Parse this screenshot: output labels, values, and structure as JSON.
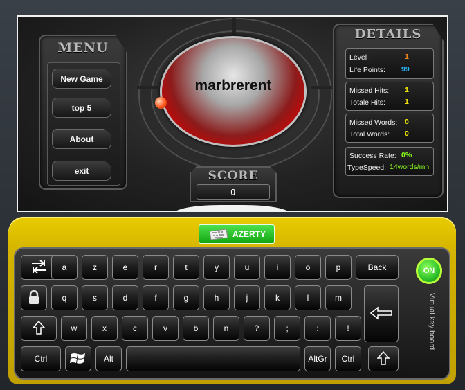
{
  "menu": {
    "title": "MENU",
    "items": [
      "New Game",
      "top 5",
      "About",
      "exit"
    ]
  },
  "details": {
    "title": "DETAILS",
    "level_label": "Level   :",
    "level_value": "1",
    "life_label": "Life Points:",
    "life_value": "99",
    "missed_hits_label": "Missed Hits:",
    "missed_hits_value": "1",
    "total_hits_label": "Totale Hits:",
    "total_hits_value": "1",
    "missed_words_label": "Missed Words:",
    "missed_words_value": "0",
    "total_words_label": "Total Words:",
    "total_words_value": "0",
    "success_label": "Success Rate:",
    "success_value": "0%",
    "speed_label": "TypeSpeed:",
    "speed_value": "14words/mn"
  },
  "game": {
    "current_word": "marbrerent"
  },
  "score": {
    "title": "SCORE",
    "value": "0"
  },
  "keyboard": {
    "layout_label": "AZERTY",
    "on_label": "ON",
    "side_label": "Virtual key board",
    "row1": [
      "a",
      "z",
      "e",
      "r",
      "t",
      "y",
      "u",
      "i",
      "o",
      "p"
    ],
    "back": "Back",
    "row2": [
      "q",
      "s",
      "d",
      "f",
      "g",
      "h",
      "j",
      "k",
      "l",
      "m"
    ],
    "row3": [
      "w",
      "x",
      "c",
      "v",
      "b",
      "n",
      "?",
      ";",
      ":",
      "!"
    ],
    "ctrl_left": "Ctrl",
    "alt": "Alt",
    "altgr": "AltGr",
    "ctrl_right": "Ctrl"
  },
  "colors": {
    "level_value": "#ff8c1a",
    "life_value": "#29b6f6",
    "yellow_value": "#f5e800",
    "green_value": "#8cff1a",
    "keyboard_frame": "#d4b400",
    "layout_button": "#22b822"
  },
  "icons": {
    "tab_key": "tab-arrows-icon",
    "caps_key": "lock-icon",
    "shift_keys": "shift-arrow-icon",
    "enter_key": "enter-arrow-icon",
    "windows_key": "windows-logo-icon",
    "layout_button": "keyboard-icon"
  }
}
